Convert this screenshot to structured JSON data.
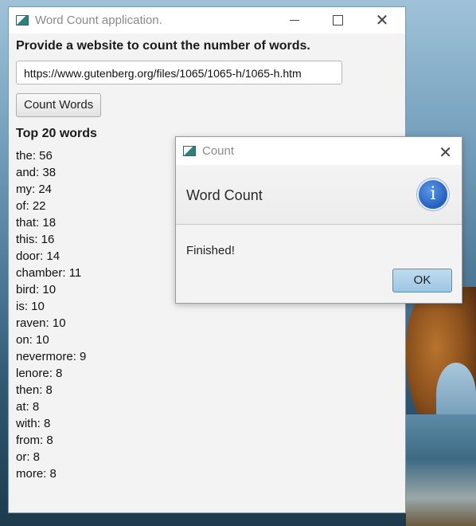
{
  "main_window": {
    "title": "Word Count application.",
    "prompt": "Provide a website to count the number of words.",
    "url_value": "https://www.gutenberg.org/files/1065/1065-h/1065-h.htm",
    "count_button": "Count Words",
    "top_title": "Top 20 words",
    "words": [
      "the: 56",
      "and: 38",
      "my: 24",
      "of: 22",
      "that: 18",
      "this: 16",
      "door: 14",
      "chamber: 11",
      "bird: 10",
      "is: 10",
      "raven: 10",
      "on: 10",
      "nevermore: 9",
      "lenore: 8",
      "then: 8",
      "at: 8",
      "with: 8",
      "from: 8",
      "or: 8",
      "more: 8"
    ]
  },
  "dialog": {
    "title": "Count",
    "heading": "Word Count",
    "message": "Finished!",
    "ok_button": "OK",
    "icon": "info-icon",
    "icon_glyph": "i"
  },
  "titlebar_glyphs": {
    "close": "✕"
  },
  "colors": {
    "accent": "#245fbf",
    "ok_button": "#9ec6e3"
  }
}
